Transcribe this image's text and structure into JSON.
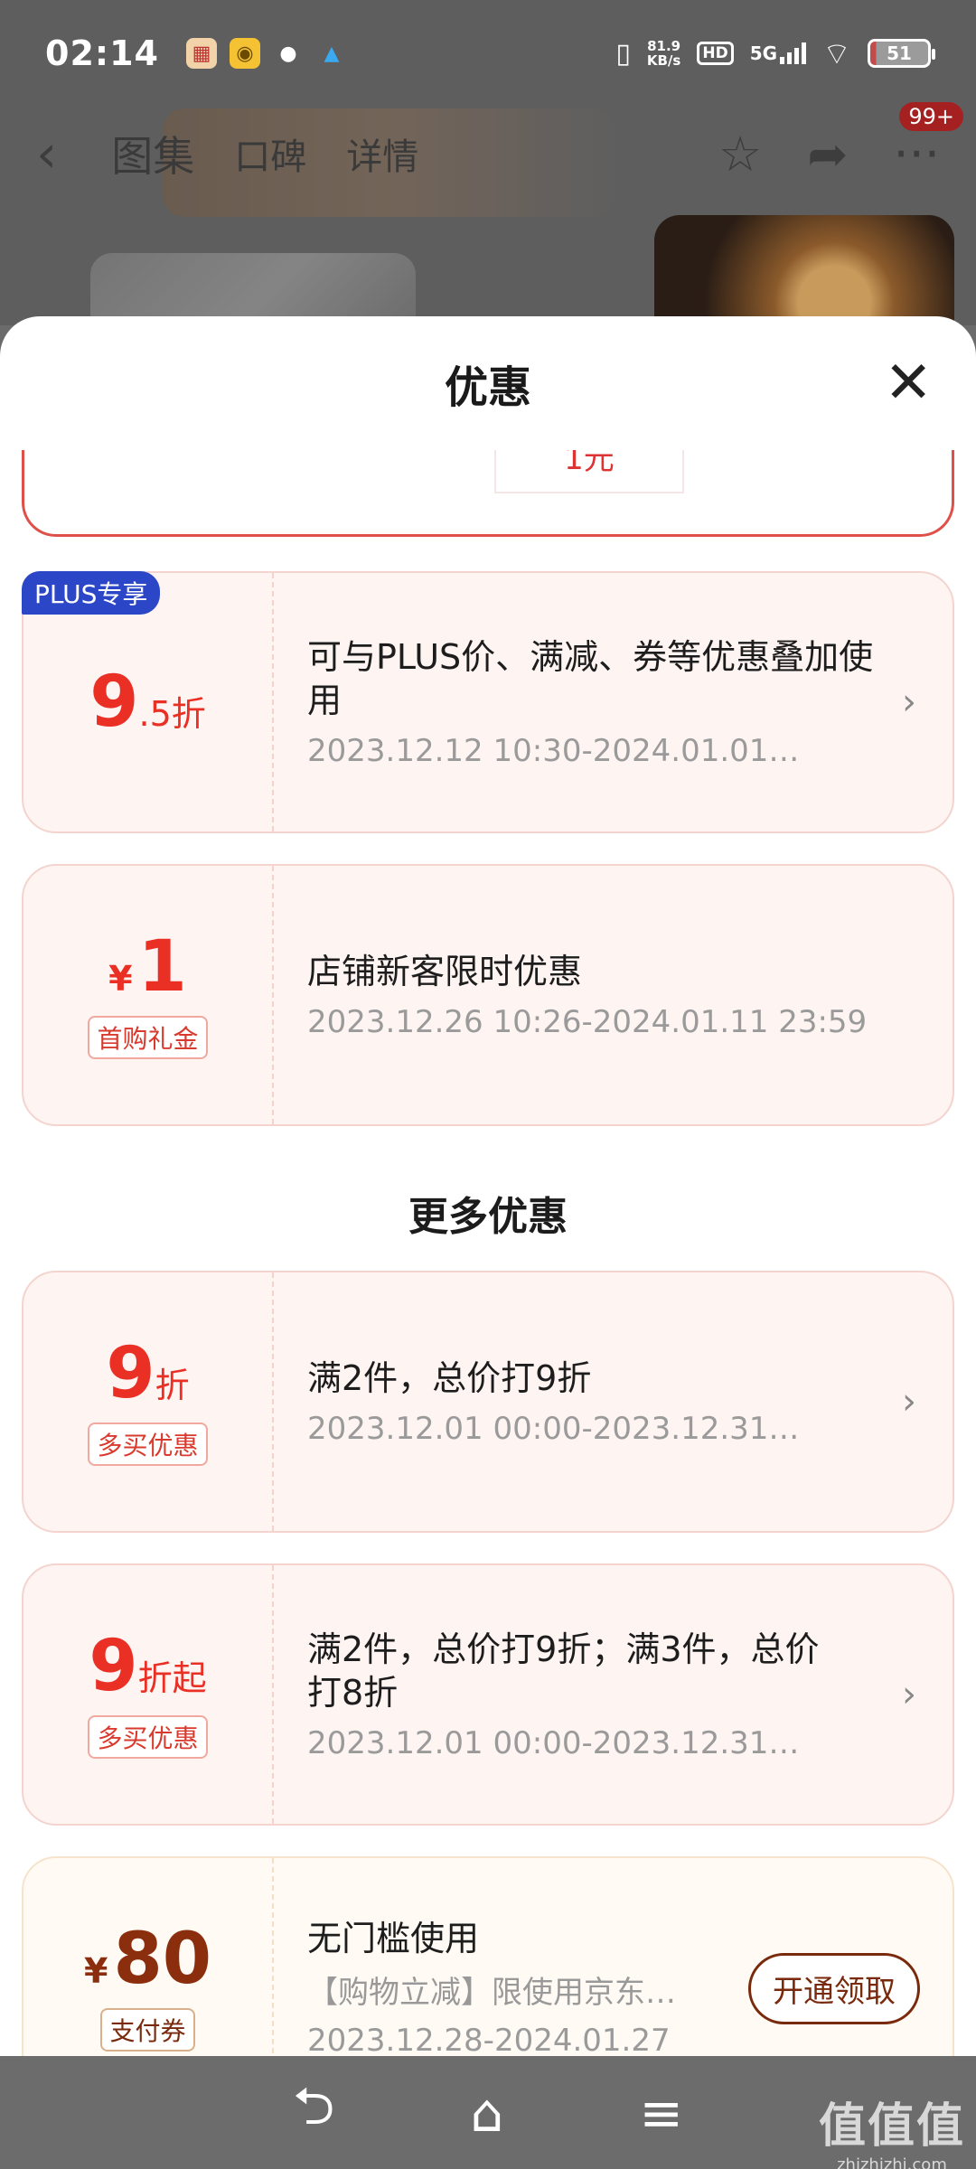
{
  "status_bar": {
    "time": "02:14",
    "net_speed_value": "81.9",
    "net_speed_unit": "KB/s",
    "hd": "HD",
    "network": "5G",
    "battery": "51"
  },
  "top_nav": {
    "tabs": [
      "图集",
      "口碑",
      "详情"
    ],
    "badge": "99+"
  },
  "sheet": {
    "title": "优惠",
    "partial_chip": "1元"
  },
  "cards": [
    {
      "badge": "PLUS专享",
      "amount_big": "9",
      "amount_small": ".5折",
      "description": "可与PLUS价、满减、券等优惠叠加使用",
      "period": "2023.12.12 10:30-2024.01.01…"
    },
    {
      "currency": "¥",
      "amount_big": "1",
      "tag": "首购礼金",
      "description": "店铺新客限时优惠",
      "period": "2023.12.26 10:26-2024.01.11 23:59"
    }
  ],
  "more_section_title": "更多优惠",
  "more_cards": [
    {
      "amount_big": "9",
      "amount_small": "折",
      "tag": "多买优惠",
      "description": "满2件，总价打9折",
      "period": "2023.12.01 00:00-2023.12.31…"
    },
    {
      "amount_big": "9",
      "amount_small": "折起",
      "tag": "多买优惠",
      "description": "满2件，总价打9折；满3件，总价打8折",
      "period": "2023.12.01 00:00-2023.12.31…"
    },
    {
      "currency": "¥",
      "amount_big": "80",
      "tag": "支付券",
      "description": "无门槛使用",
      "sub_description": "【购物立减】限使用京东…",
      "period": "2023.12.28-2024.01.27",
      "button": "开通领取"
    }
  ],
  "watermark": {
    "main": "值值值",
    "sub": "zhizhizhi.com"
  }
}
